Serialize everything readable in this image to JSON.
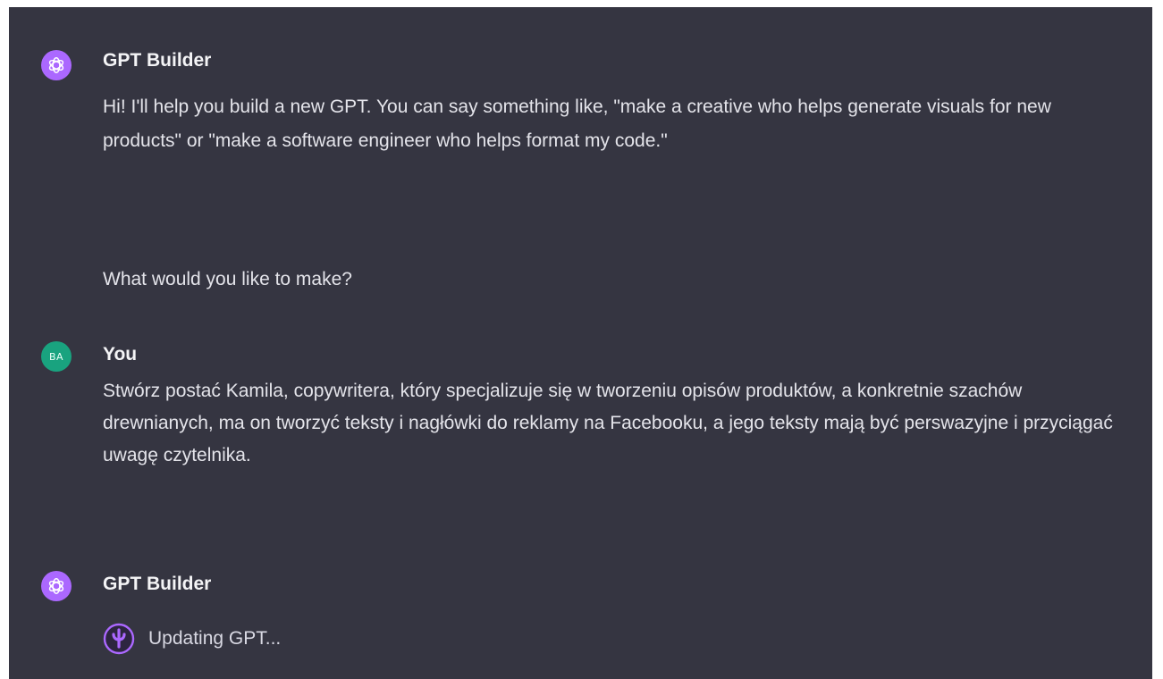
{
  "messages": [
    {
      "author": "GPT Builder",
      "avatar_icon": "openai-logo-icon",
      "paragraphs": [
        "Hi! I'll help you build a new GPT. You can say something like, \"make a creative who helps generate visuals for new products\" or \"make a software engineer who helps format my code.\"",
        "What would you like to make?"
      ]
    },
    {
      "author": "You",
      "avatar_initials": "BA",
      "text": "Stwórz postać Kamila, copywritera, który specjalizuje się w tworzeniu opisów produktów, a konkretnie szachów drewnianych, ma on tworzyć teksty i nagłówki do reklamy na Facebooku, a jego teksty mają być perswazyjne i przyciągać uwagę czytelnika."
    },
    {
      "author": "GPT Builder",
      "avatar_icon": "openai-logo-icon",
      "status_icon": "updating-gpt-icon",
      "status": "Updating GPT..."
    }
  ],
  "colors": {
    "background": "#353541",
    "gpt_avatar": "#ab68ff",
    "user_avatar": "#19a37f",
    "text": "#ececf1"
  }
}
